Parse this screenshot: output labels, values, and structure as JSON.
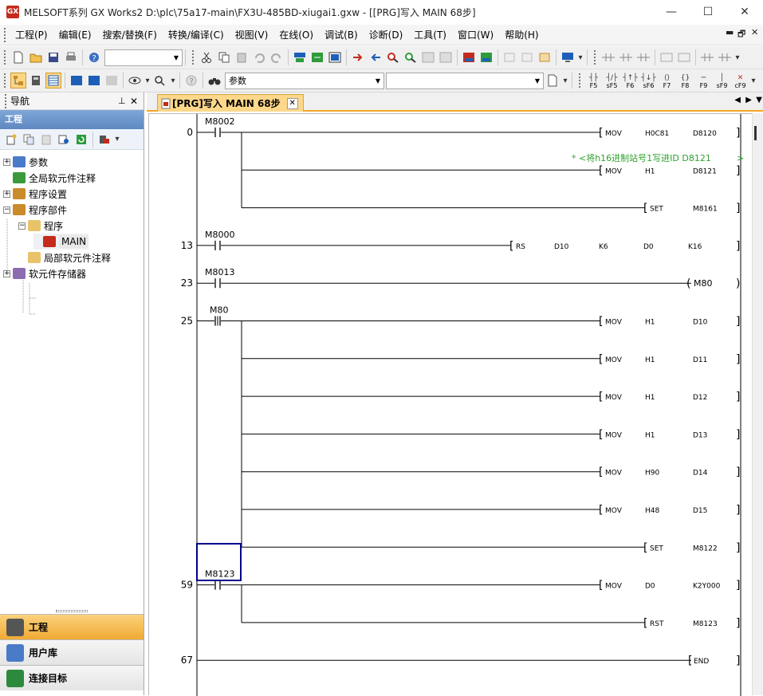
{
  "window": {
    "title": "MELSOFT系列 GX Works2 D:\\plc\\75a17-main\\FX3U-485BD-xiugai1.gxw - [[PRG]写入 MAIN 68步]",
    "app_icon": "GX",
    "controls": {
      "minimize": "—",
      "maximize": "☐",
      "close": "✕"
    }
  },
  "menu": [
    "工程(P)",
    "编辑(E)",
    "搜索/替换(F)",
    "转换/编译(C)",
    "视图(V)",
    "在线(O)",
    "调试(B)",
    "诊断(D)",
    "工具(T)",
    "窗口(W)",
    "帮助(H)"
  ],
  "mdi_controls": [
    "▬",
    "🗗",
    "✕"
  ],
  "toolbar": {
    "search_combo": "",
    "param_combo": "参数",
    "fkeys": [
      "F5",
      "sF5",
      "F6",
      "sF6",
      "F7",
      "F8",
      "F9",
      "sF9",
      "cF9"
    ]
  },
  "navigation": {
    "title": "导航",
    "pin": "ᵖ",
    "close": "✕",
    "section": "工程",
    "tree": [
      {
        "label": "参数",
        "expander": "+",
        "indent": 0,
        "icon": "params-icon"
      },
      {
        "label": "全局软元件注释",
        "expander": "",
        "indent": 0,
        "icon": "global-comment-icon"
      },
      {
        "label": "程序设置",
        "expander": "+",
        "indent": 0,
        "icon": "program-setting-icon"
      },
      {
        "label": "程序部件",
        "expander": "−",
        "indent": 0,
        "icon": "program-parts-icon"
      },
      {
        "label": "程序",
        "expander": "−",
        "indent": 1,
        "icon": "folder-icon"
      },
      {
        "label": "MAIN",
        "expander": "",
        "indent": 2,
        "icon": "main-program-icon"
      },
      {
        "label": "局部软元件注释",
        "expander": "",
        "indent": 1,
        "icon": "folder-icon"
      },
      {
        "label": "软元件存储器",
        "expander": "+",
        "indent": 0,
        "icon": "device-memory-icon"
      }
    ],
    "bottom_tabs": [
      "工程",
      "用户库",
      "连接目标"
    ]
  },
  "editor": {
    "tab_label": "[PRG]写入 MAIN 68步",
    "rungs": [
      {
        "step": "0",
        "contact": "M8002",
        "contact_type": "NO",
        "outputs": [
          {
            "type": "app",
            "op": "MOV",
            "args": [
              "H0C81",
              "D8120"
            ]
          },
          {
            "type": "comment",
            "text": "* <将h16进制站号1写进ID D8121"
          },
          {
            "type": "app",
            "op": "MOV",
            "args": [
              "H1",
              "D8121"
            ]
          },
          {
            "type": "app",
            "op": "SET",
            "args": [
              "",
              "M8161"
            ]
          }
        ]
      },
      {
        "step": "13",
        "contact": "M8000",
        "contact_type": "NO",
        "outputs": [
          {
            "type": "rs",
            "op": "RS",
            "args": [
              "D10",
              "K6",
              "D0",
              "K16"
            ]
          }
        ]
      },
      {
        "step": "23",
        "contact": "M8013",
        "contact_type": "NO",
        "outputs": [
          {
            "type": "coil",
            "op": "M80",
            "args": []
          }
        ]
      },
      {
        "step": "25",
        "contact": "M80",
        "contact_type": "PLS",
        "outputs": [
          {
            "type": "app",
            "op": "MOV",
            "args": [
              "H1",
              "D10"
            ]
          },
          {
            "type": "app",
            "op": "MOV",
            "args": [
              "H1",
              "D11"
            ]
          },
          {
            "type": "app",
            "op": "MOV",
            "args": [
              "H1",
              "D12"
            ]
          },
          {
            "type": "app",
            "op": "MOV",
            "args": [
              "H1",
              "D13"
            ]
          },
          {
            "type": "app",
            "op": "MOV",
            "args": [
              "H90",
              "D14"
            ]
          },
          {
            "type": "app",
            "op": "MOV",
            "args": [
              "H48",
              "D15"
            ]
          },
          {
            "type": "app",
            "op": "SET",
            "args": [
              "",
              "M8122"
            ]
          }
        ]
      },
      {
        "step": "59",
        "contact": "M8123",
        "contact_type": "NO",
        "outputs": [
          {
            "type": "app",
            "op": "MOV",
            "args": [
              "D0",
              "K2Y000"
            ]
          },
          {
            "type": "app",
            "op": "RST",
            "args": [
              "",
              "M8123"
            ]
          }
        ]
      },
      {
        "step": "67",
        "contact": "",
        "contact_type": "",
        "outputs": [
          {
            "type": "end",
            "op": "END",
            "args": []
          }
        ]
      }
    ]
  },
  "colors": {
    "comment": "#2fa12f",
    "cursor": "#00008b",
    "active_tab": "#fdd88a",
    "nav_selected": "#f5b43c"
  }
}
